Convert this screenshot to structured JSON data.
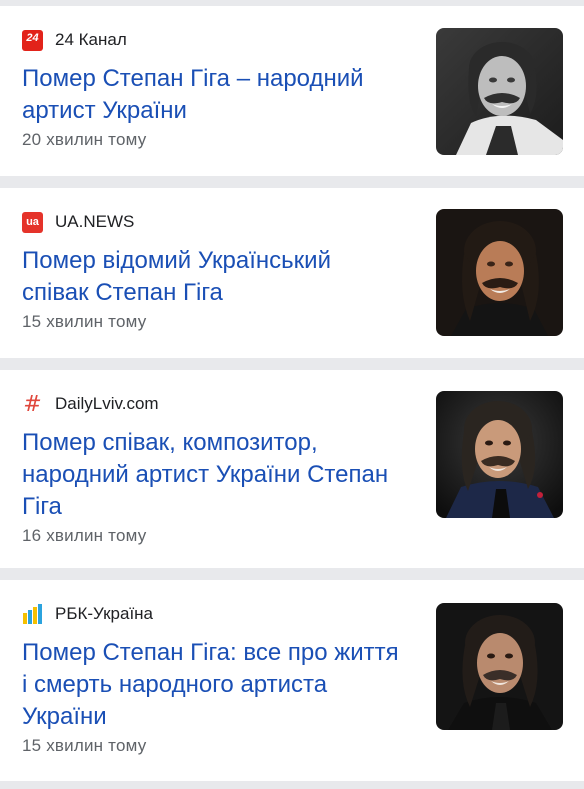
{
  "articles": [
    {
      "source": "24 Канал",
      "source_icon": "channel-24-logo-icon",
      "source_icon_text": "24",
      "headline": "Помер Степан Гіга – народний артист України",
      "time": "20 хвилин тому",
      "thumbnail": "portrait-photo-grayscale"
    },
    {
      "source": "UA.NEWS",
      "source_icon": "ua-news-logo-icon",
      "source_icon_text": "ua",
      "headline": "Помер відомий Український співак Степан Гіга",
      "time": "15 хвилин тому",
      "thumbnail": "portrait-photo"
    },
    {
      "source": "DailyLviv.com",
      "source_icon": "hash-logo-icon",
      "source_icon_text": "#",
      "headline": "Помер співак, композитор, народний артист України Степан Гіга",
      "time": "16 хвилин тому",
      "thumbnail": "portrait-photo"
    },
    {
      "source": "РБК-Україна",
      "source_icon": "rbk-ukraina-logo-icon",
      "headline": "Помер Степан Гіга: все про життя і смерть народного артиста України",
      "time": "15 хвилин тому",
      "thumbnail": "portrait-photo"
    }
  ],
  "colors": {
    "headline": "#1a4fb5",
    "source_text": "#202124",
    "time_text": "#5f6368",
    "separator": "#e8e9ec"
  }
}
